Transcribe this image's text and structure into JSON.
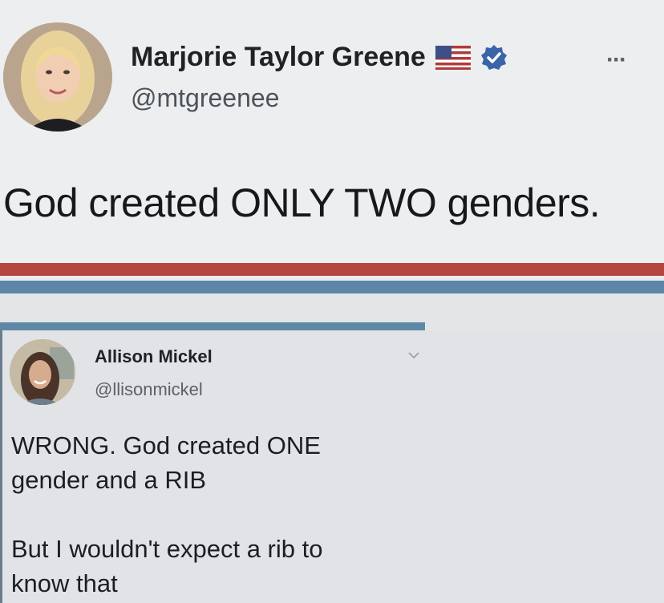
{
  "top_tweet": {
    "author_name": "Marjorie Taylor Greene",
    "handle": "@mtgreenee",
    "text": "God created ONLY TWO genders.",
    "icons": {
      "flag": "us-flag-icon",
      "verified": "verified-badge-icon",
      "more": "more-options-icon"
    },
    "more_label": "···"
  },
  "reply_tweet": {
    "author_name": "Allison Mickel",
    "handle": "@llisonmickel",
    "text_lines": [
      "WRONG. God created ONE",
      "gender and a RIB",
      "But I wouldn't expect a rib to",
      "know that"
    ],
    "icons": {
      "chevron": "chevron-down-icon"
    }
  },
  "colors": {
    "stripe_red": "#b5453f",
    "stripe_blue": "#5d87a8",
    "verified_blue": "#3a64a8"
  }
}
